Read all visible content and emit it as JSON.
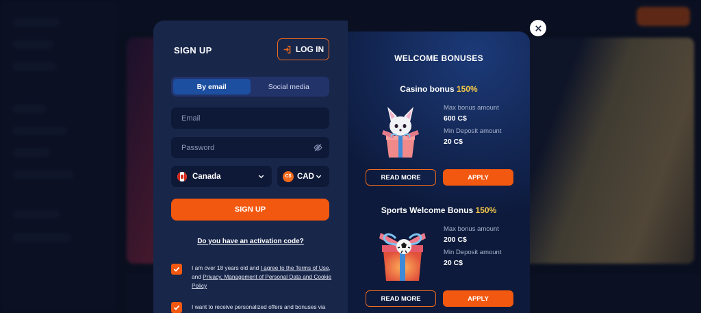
{
  "signup": {
    "title": "SIGN UP",
    "login_label": "LOG IN",
    "tabs": [
      {
        "label": "By email",
        "active": true
      },
      {
        "label": "Social media",
        "active": false
      }
    ],
    "email_placeholder": "Email",
    "password_placeholder": "Password",
    "country": "Canada",
    "currency": "CAD",
    "currency_icon_text": "C$",
    "submit_label": "SIGN UP",
    "activation_link": "Do you have an activation code?",
    "consent_1": {
      "text_a": "I am over 18 years old and ",
      "link_a": "I agree to the Terms of Use",
      "text_b": ", and ",
      "link_b": "Privacy, Management of Personal Data and Cookie Policy",
      "checked": true
    },
    "consent_2": {
      "text": "I want to receive personalized offers and bonuses via",
      "checked": true
    }
  },
  "bonuses": {
    "title": "WELCOME BONUSES",
    "items": [
      {
        "name": "Casino bonus",
        "percent": "150%",
        "max_label": "Max bonus amount",
        "max_value": "600 C$",
        "min_label": "Min Deposit amount",
        "min_value": "20 C$",
        "read_more": "READ MORE",
        "apply": "APPLY"
      },
      {
        "name": "Sports Welcome Bonus",
        "percent": "150%",
        "max_label": "Max bonus amount",
        "max_value": "200 C$",
        "min_label": "Min Deposit amount",
        "min_value": "20 C$",
        "read_more": "READ MORE",
        "apply": "APPLY"
      }
    ]
  },
  "colors": {
    "accent": "#f2580f",
    "highlight": "#f7c948",
    "panel_left": "#18264a",
    "panel_right": "#0d1a3c"
  },
  "icons": [
    "login-icon",
    "eye-off-icon",
    "chevron-down-icon",
    "checkmark-icon",
    "close-icon",
    "canada-flag-icon"
  ]
}
